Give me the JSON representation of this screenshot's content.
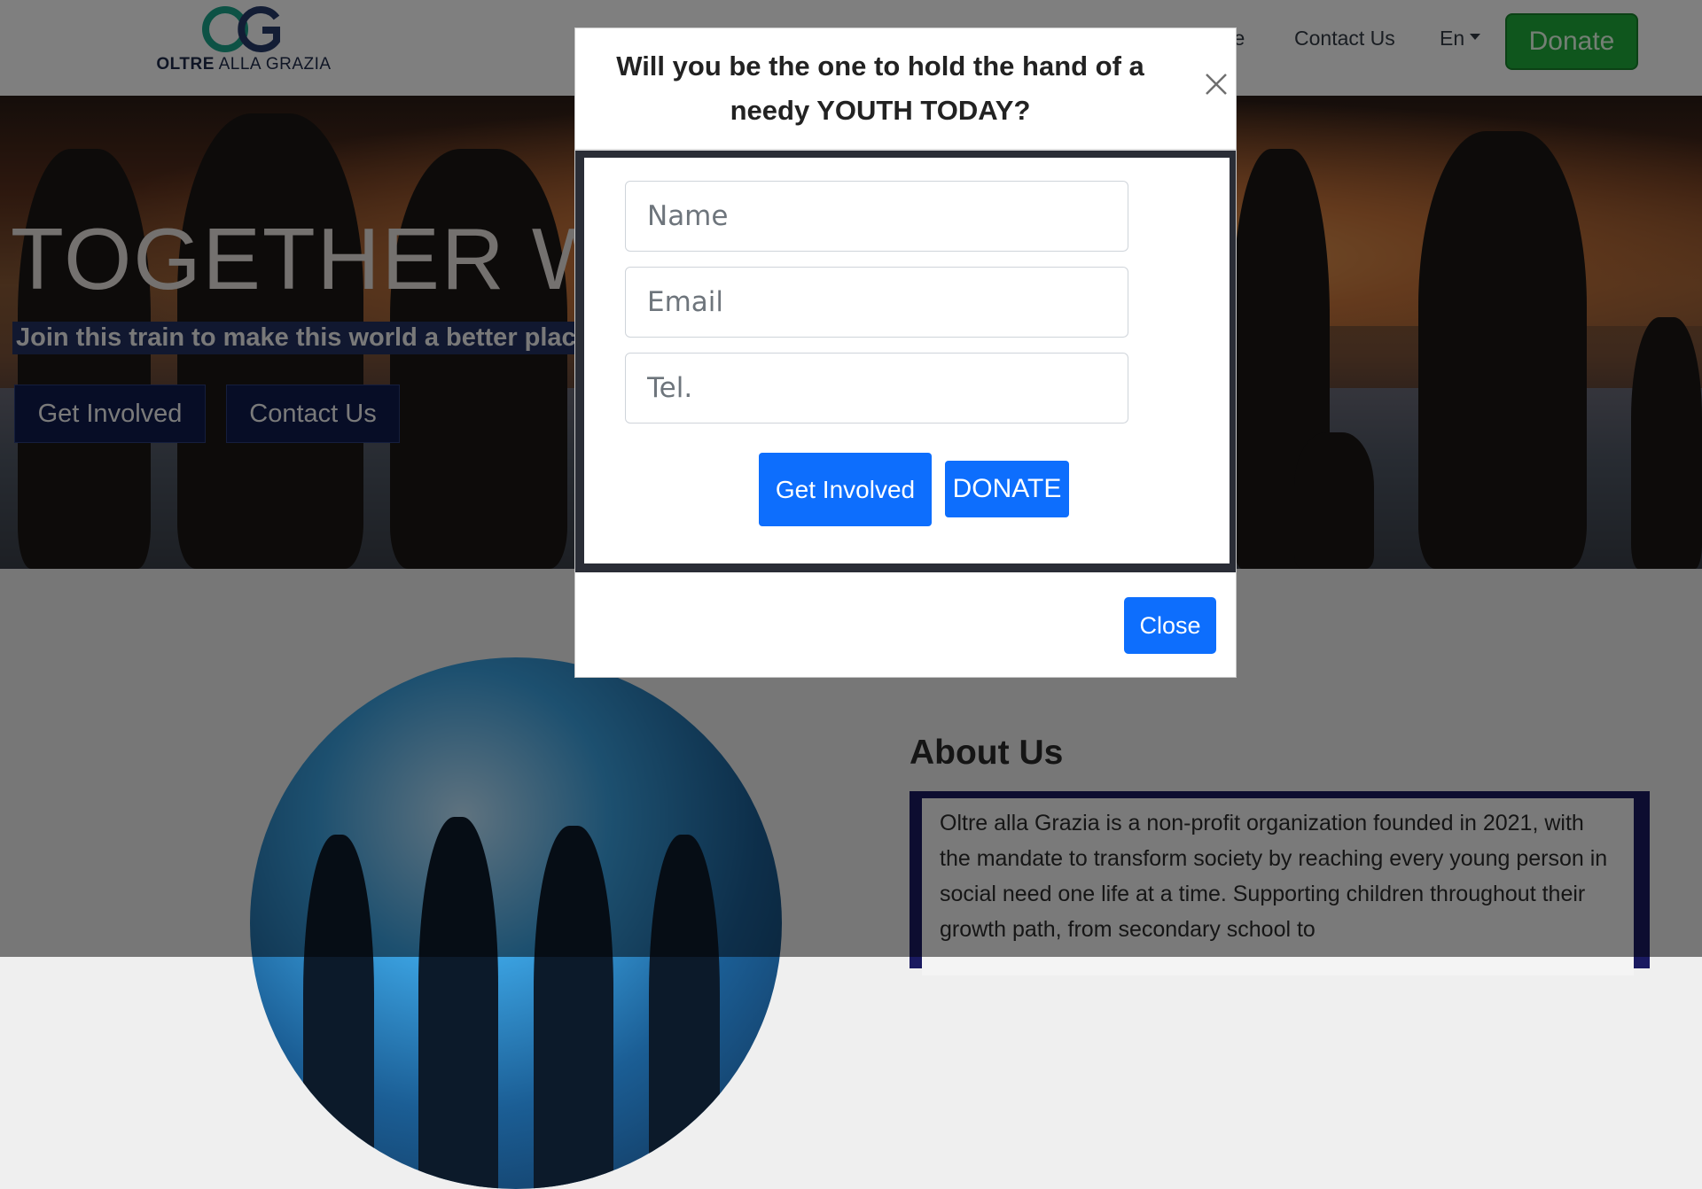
{
  "navbar": {
    "logo_text_bold": "OLTRE",
    "logo_text_light": "ALLA GRAZIA",
    "partial_link": "ve",
    "contact_link": "Contact Us",
    "language": "En",
    "donate_label": "Donate",
    "donate_color": "#1ead3a"
  },
  "hero": {
    "title": "TOGETHER W",
    "subtitle": "Join this train to make this world a  better plac",
    "get_involved_label": "Get Involved",
    "contact_label": "Contact Us"
  },
  "about": {
    "title": "About Us",
    "text": "Oltre alla Grazia is a non-profit organization founded in 2021, with the mandate to transform society by reaching every young person in social need one life at a time. Supporting children throughout their growth path, from secondary school to"
  },
  "modal": {
    "title": "Will you be the one to hold the hand of a needy YOUTH TODAY?",
    "close_icon": "close-icon",
    "name_placeholder": "Name",
    "email_placeholder": "Email",
    "tel_placeholder": "Tel.",
    "get_involved_label": "Get Involved",
    "donate_label": "DONATE",
    "close_label": "Close",
    "accent_color": "#0d6efd"
  }
}
